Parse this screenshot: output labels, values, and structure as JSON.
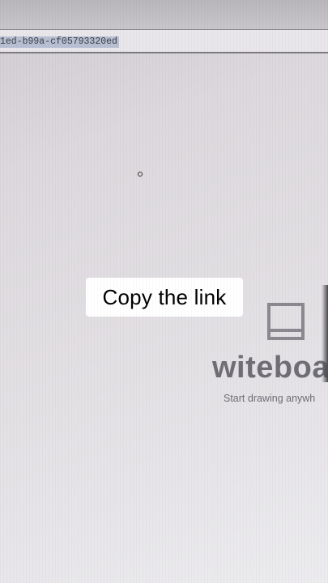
{
  "browser": {
    "url_fragment": "1ed-b99a-cf05793320ed"
  },
  "overlay": {
    "caption": "Copy the link"
  },
  "app": {
    "brand": "witeboa",
    "tagline": "Start drawing anywh",
    "icon": "whiteboard-icon"
  },
  "colors": {
    "brand_gray": "#6f6e75",
    "url_selection": "#b7bfd3",
    "caption_bg": "#ffffff"
  }
}
